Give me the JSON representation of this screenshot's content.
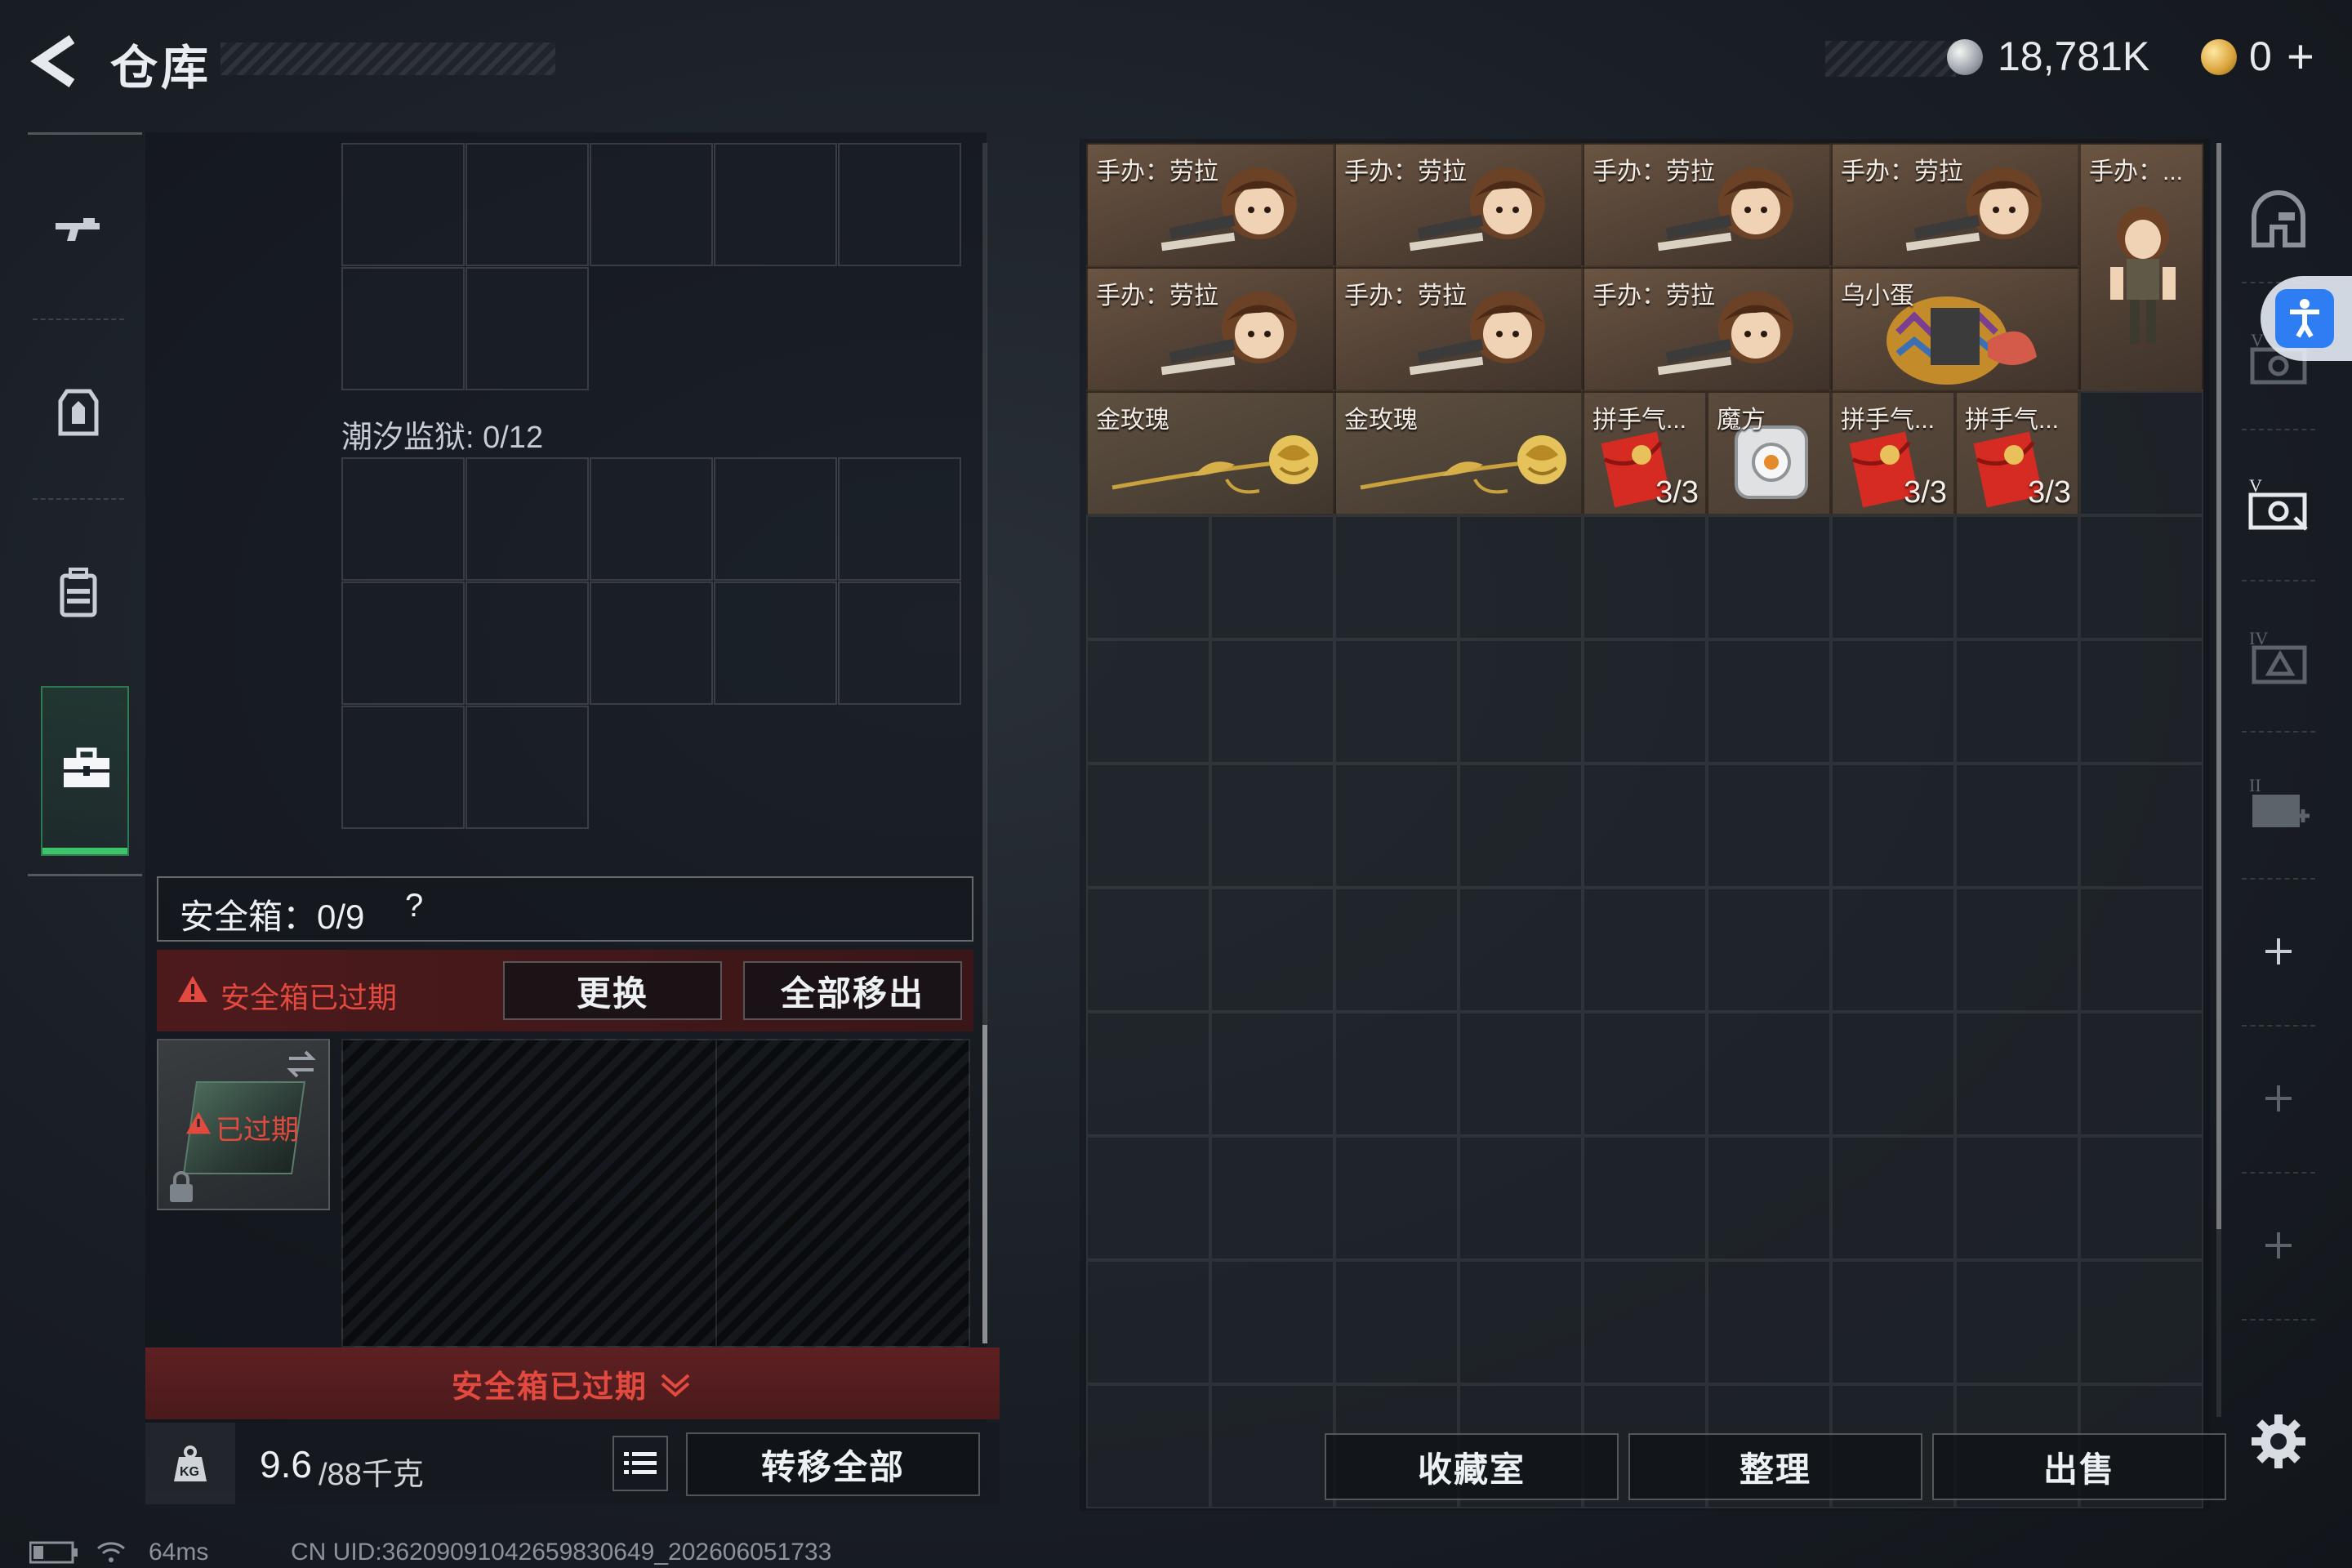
{
  "header": {
    "title": "仓库",
    "currency_main": "18,781K",
    "currency_second": "0",
    "add_label": "+"
  },
  "sidebar": {
    "items": [
      {
        "name": "weapon",
        "icon": "gun-icon"
      },
      {
        "name": "armor",
        "icon": "vest-icon"
      },
      {
        "name": "backpack",
        "icon": "backpack-icon"
      },
      {
        "name": "safebox",
        "icon": "toolbox-icon",
        "active": true
      }
    ]
  },
  "middle": {
    "container_label": "潮汐监狱: 0/12",
    "safebox_label": "安全箱：0/9",
    "safebox_help": "?",
    "expired_warning": "安全箱已过期",
    "replace_button": "更换",
    "remove_all_button": "全部移出",
    "expired_badge": "已过期",
    "expired_banner": "安全箱已过期",
    "weight_value": "9.6",
    "weight_total": "/88千克",
    "weight_icon_label": "KG",
    "transfer_all_button": "转移全部"
  },
  "inventory": {
    "items": [
      {
        "name": "手办：劳拉",
        "type": "figure"
      },
      {
        "name": "手办：劳拉",
        "type": "figure"
      },
      {
        "name": "手办：劳拉",
        "type": "figure"
      },
      {
        "name": "手办：劳拉",
        "type": "figure"
      },
      {
        "name": "手办：...",
        "type": "figure-tall"
      },
      {
        "name": "手办：劳拉",
        "type": "figure"
      },
      {
        "name": "手办：劳拉",
        "type": "figure"
      },
      {
        "name": "手办：劳拉",
        "type": "figure"
      },
      {
        "name": "乌小蛋",
        "type": "egg"
      },
      {
        "name": "金玫瑰",
        "type": "rose"
      },
      {
        "name": "金玫瑰",
        "type": "rose"
      },
      {
        "name": "拼手气...",
        "type": "redpacket",
        "count": "3/3"
      },
      {
        "name": "魔方",
        "type": "cube"
      },
      {
        "name": "拼手气...",
        "type": "redpacket",
        "count": "3/3"
      },
      {
        "name": "拼手气...",
        "type": "redpacket",
        "count": "3/3"
      }
    ],
    "collection_button": "收藏室",
    "organize_button": "整理",
    "sell_button": "出售"
  },
  "right_rail": {
    "items": [
      "helmet-icon",
      "armor-level-v-icon",
      "armor-level-v-active-icon",
      "armor-level-iv-icon",
      "medkit-level-ii-icon",
      "add-slot-icon",
      "add-slot-icon",
      "add-slot-icon"
    ]
  },
  "footer": {
    "ping": "64ms",
    "uid": "CN UID:36209091042659830649_202606051733"
  },
  "colors": {
    "accent_green": "#3ec36b",
    "warning_red": "#e24a3f",
    "banner_red": "#5a1f1f",
    "accessibility_blue": "#2f7df3"
  }
}
